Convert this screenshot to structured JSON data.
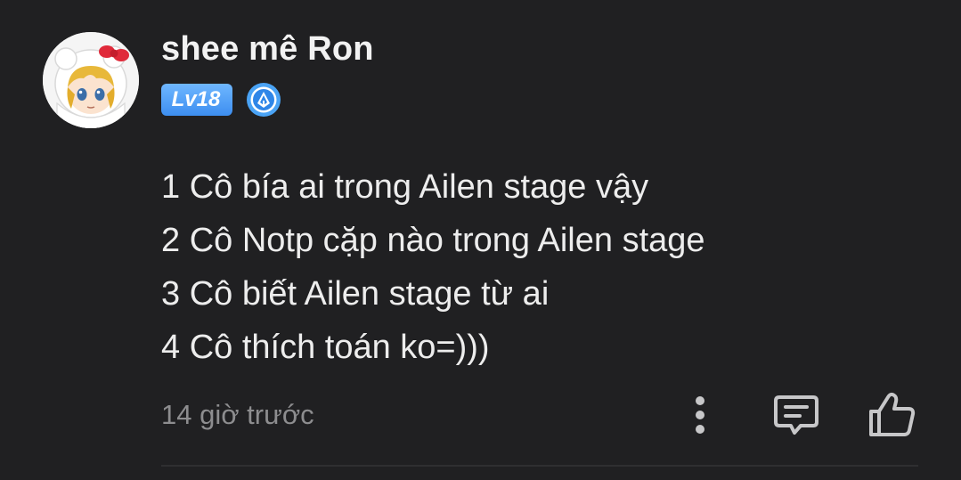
{
  "comment": {
    "username": "shee mê Ron",
    "level_badge": "Lv18",
    "lines": [
      "1 Cô bía ai trong Ailen stage vậy",
      "2 Cô Notp cặp nào trong Ailen stage",
      "3 Cô biết Ailen stage từ ai",
      "4 Cô thích toán ko=)))"
    ],
    "timestamp": "14 giờ trước"
  },
  "actions": {
    "more_icon": "more-vertical-icon",
    "reply_icon": "comment-reply-icon",
    "like_icon": "thumbs-up-icon"
  },
  "colors": {
    "background": "#202022",
    "badge": "#4a9bf5",
    "timestamp": "#8d8d8f"
  }
}
